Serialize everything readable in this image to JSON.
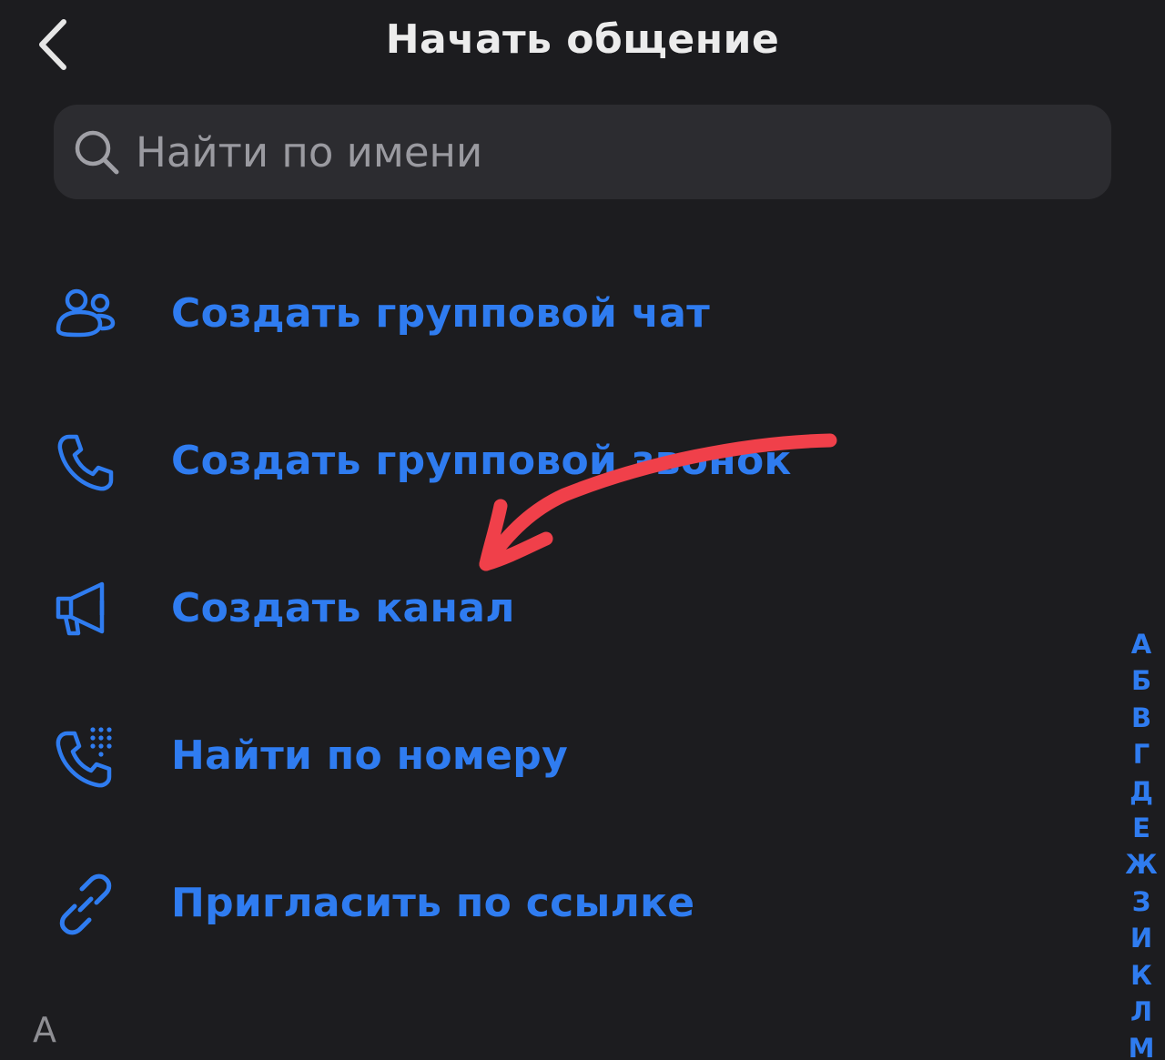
{
  "header": {
    "title": "Начать общение",
    "back_icon": "chevron-left-icon"
  },
  "search": {
    "placeholder": "Найти по имени",
    "value": "",
    "icon": "search-icon"
  },
  "actions": [
    {
      "label": "Создать групповой чат",
      "icon": "group-icon"
    },
    {
      "label": "Создать групповой звонок",
      "icon": "phone-icon"
    },
    {
      "label": "Создать канал",
      "icon": "megaphone-icon"
    },
    {
      "label": "Найти по номеру",
      "icon": "dialpad-phone-icon"
    },
    {
      "label": "Пригласить по ссылке",
      "icon": "link-icon"
    }
  ],
  "contacts_section": {
    "letter": "А"
  },
  "alphabet_index": [
    "А",
    "Б",
    "В",
    "Г",
    "Д",
    "Е",
    "Ж",
    "З",
    "И",
    "К",
    "Л",
    "М"
  ],
  "annotation": {
    "type": "hand-drawn-arrow",
    "color": "#f0404a",
    "points_to": "Создать канал"
  },
  "colors": {
    "background": "#1c1c1f",
    "accent": "#2f7cf0",
    "search_background": "#2c2c30",
    "title": "#ececec",
    "placeholder": "#9a9aa0"
  }
}
